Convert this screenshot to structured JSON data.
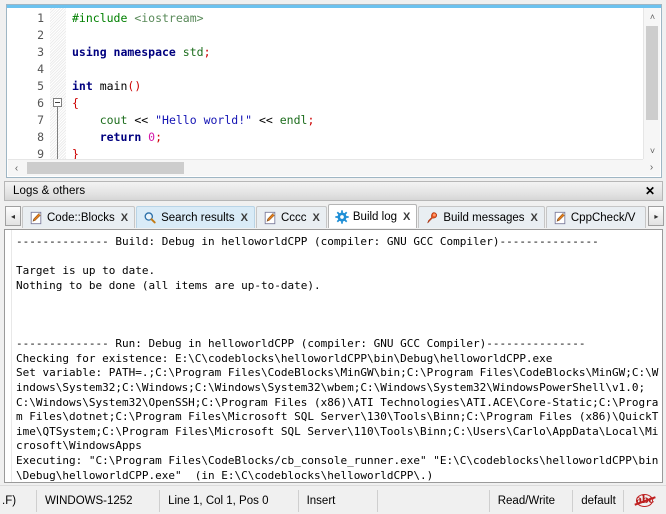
{
  "editor": {
    "line_numbers": [
      "1",
      "2",
      "3",
      "4",
      "5",
      "6",
      "7",
      "8",
      "9"
    ],
    "code_lines": [
      [
        {
          "t": "#include ",
          "c": "tok-pre"
        },
        {
          "t": "<iostream>",
          "c": "tok-inc"
        }
      ],
      [],
      [
        {
          "t": "using namespace ",
          "c": "tok-kw"
        },
        {
          "t": "std",
          "c": "tok-std"
        },
        {
          "t": ";",
          "c": "tok-op"
        }
      ],
      [],
      [
        {
          "t": "int ",
          "c": "tok-type"
        },
        {
          "t": "main",
          "c": "tok-id"
        },
        {
          "t": "()",
          "c": "tok-op"
        }
      ],
      [
        {
          "t": "{",
          "c": "tok-op"
        }
      ],
      [
        {
          "t": "    ",
          "c": "tok-plain"
        },
        {
          "t": "cout",
          "c": "tok-fn"
        },
        {
          "t": " << ",
          "c": "tok-plain"
        },
        {
          "t": "\"Hello world!\"",
          "c": "tok-str"
        },
        {
          "t": " << ",
          "c": "tok-plain"
        },
        {
          "t": "endl",
          "c": "tok-fn"
        },
        {
          "t": ";",
          "c": "tok-op"
        }
      ],
      [
        {
          "t": "    ",
          "c": "tok-plain"
        },
        {
          "t": "return ",
          "c": "tok-kw"
        },
        {
          "t": "0",
          "c": "tok-num"
        },
        {
          "t": ";",
          "c": "tok-op"
        }
      ],
      [
        {
          "t": "}",
          "c": "tok-op"
        }
      ]
    ],
    "fold_marker_line": 6,
    "scrollbar": {
      "up_arrow": "˄",
      "down_arrow": "˅",
      "left_arrow": "‹",
      "right_arrow": "›"
    }
  },
  "logs_panel": {
    "title": "Logs & others",
    "close_label": "✕",
    "nav_left": "◂",
    "nav_right": "▸",
    "tabs": [
      {
        "label": "Code::Blocks",
        "icon": "notepad-pencil-icon",
        "close": "X",
        "state": "normal"
      },
      {
        "label": "Search results",
        "icon": "magnifier-icon",
        "close": "X",
        "state": "highlight"
      },
      {
        "label": "Cccc",
        "icon": "notepad-pencil-icon",
        "close": "X",
        "state": "normal"
      },
      {
        "label": "Build log",
        "icon": "gear-icon",
        "close": "X",
        "state": "active"
      },
      {
        "label": "Build messages",
        "icon": "pushpin-icon",
        "close": "X",
        "state": "normal"
      },
      {
        "label": "CppCheck/V",
        "icon": "notepad-pencil-icon",
        "close": "",
        "state": "normal"
      }
    ],
    "log_text": "-------------- Build: Debug in helloworldCPP (compiler: GNU GCC Compiler)---------------\n\nTarget is up to date.\nNothing to be done (all items are up-to-date).\n\n\n\n-------------- Run: Debug in helloworldCPP (compiler: GNU GCC Compiler)---------------\nChecking for existence: E:\\C\\codeblocks\\helloworldCPP\\bin\\Debug\\helloworldCPP.exe\nSet variable: PATH=.;C:\\Program Files\\CodeBlocks\\MinGW\\bin;C:\\Program Files\\CodeBlocks\\MinGW;C:\\Windows\\System32;C:\\Windows;C:\\Windows\\System32\\wbem;C:\\Windows\\System32\\WindowsPowerShell\\v1.0;C:\\Windows\\System32\\OpenSSH;C:\\Program Files (x86)\\ATI Technologies\\ATI.ACE\\Core-Static;C:\\Program Files\\dotnet;C:\\Program Files\\Microsoft SQL Server\\130\\Tools\\Binn;C:\\Program Files (x86)\\QuickTime\\QTSystem;C:\\Program Files\\Microsoft SQL Server\\110\\Tools\\Binn;C:\\Users\\Carlo\\AppData\\Local\\Microsoft\\WindowsApps\nExecuting: \"C:\\Program Files\\CodeBlocks/cb_console_runner.exe\" \"E:\\C\\codeblocks\\helloworldCPP\\bin\\Debug\\helloworldCPP.exe\"  (in E:\\C\\codeblocks\\helloworldCPP\\.)"
  },
  "statusbar": {
    "eol": ".F)",
    "encoding": "WINDOWS-1252",
    "caret": "Line 1, Col 1, Pos 0",
    "insert_mode": "Insert",
    "blank": "",
    "access": "Read/Write",
    "profile": "default",
    "spell_icon": "abc-spellcheck-off-icon",
    "spell_text": "abc"
  },
  "colors": {
    "accent_blue": "#6cc2ef",
    "tab_active_bg": "#ffffff",
    "tab_highlight_bg": "#d9ebf7",
    "panel_bg": "#f0f0f0",
    "gear_blue": "#1f8fd6",
    "pin_orange": "#e8521e",
    "pencil_orange": "#e8821e",
    "spell_red": "#b61c1c"
  }
}
